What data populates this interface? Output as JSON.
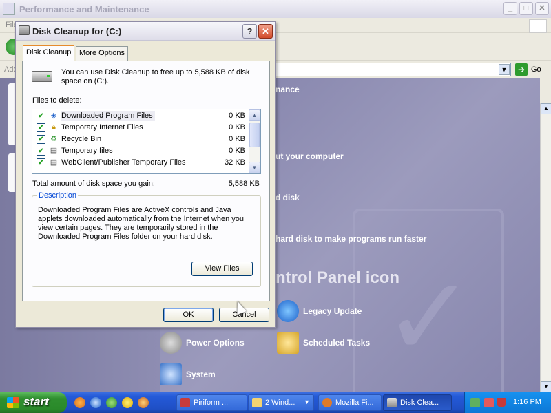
{
  "background_window": {
    "title": "Performance and Maintenance",
    "menu_first": "File",
    "address_label": "Address",
    "go_label": "Go",
    "section_header": "nance",
    "tasks": [
      "ut your computer",
      "d disk",
      "hard disk to make programs run faster"
    ],
    "control_panel_heading": "ntrol Panel icon",
    "links": {
      "legacy_update": "Legacy Update",
      "power_options": "Power Options",
      "scheduled_tasks": "Scheduled Tasks",
      "system": "System"
    }
  },
  "dialog": {
    "title": "Disk Cleanup for  (C:)",
    "help_glyph": "?",
    "close_glyph": "✕",
    "tabs": [
      "Disk Cleanup",
      "More Options"
    ],
    "intro": "You can use Disk Cleanup to free up to 5,588 KB of disk space on  (C:).",
    "files_to_delete_label": "Files to delete:",
    "files": [
      {
        "name": "Downloaded Program Files",
        "size": "0 KB",
        "checked": true,
        "icon": "program-files-icon"
      },
      {
        "name": "Temporary Internet Files",
        "size": "0 KB",
        "checked": true,
        "icon": "lock-icon"
      },
      {
        "name": "Recycle Bin",
        "size": "0 KB",
        "checked": true,
        "icon": "recycle-bin-icon"
      },
      {
        "name": "Temporary files",
        "size": "0 KB",
        "checked": true,
        "icon": "temp-files-icon"
      },
      {
        "name": "WebClient/Publisher Temporary Files",
        "size": "32 KB",
        "checked": true,
        "icon": "webclient-icon"
      }
    ],
    "total_label": "Total amount of disk space you gain:",
    "total_value": "5,588 KB",
    "description_legend": "Description",
    "description_text": "Downloaded Program Files are ActiveX controls and Java applets downloaded automatically from the Internet when you view certain pages. They are temporarily stored in the Downloaded Program Files folder on your hard disk.",
    "view_files_label": "View Files",
    "ok_label": "OK",
    "cancel_label": "Cancel"
  },
  "taskbar": {
    "start_label": "start",
    "buttons": [
      {
        "label": "Piriform ...",
        "icon": "piriform-icon",
        "active": false
      },
      {
        "label": "2 Wind...",
        "icon": "folder-icon",
        "active": false
      },
      {
        "label": "Mozilla Fi...",
        "icon": "firefox-icon",
        "active": false
      },
      {
        "label": "Disk Clea...",
        "icon": "disk-cleanup-icon",
        "active": true
      }
    ],
    "clock": "1:16 PM"
  },
  "colors": {
    "xp_blue": "#245ad8",
    "start_green": "#2f8f2f",
    "dialog_face": "#ece9d8",
    "control_panel_bg": "#8e8db2"
  }
}
